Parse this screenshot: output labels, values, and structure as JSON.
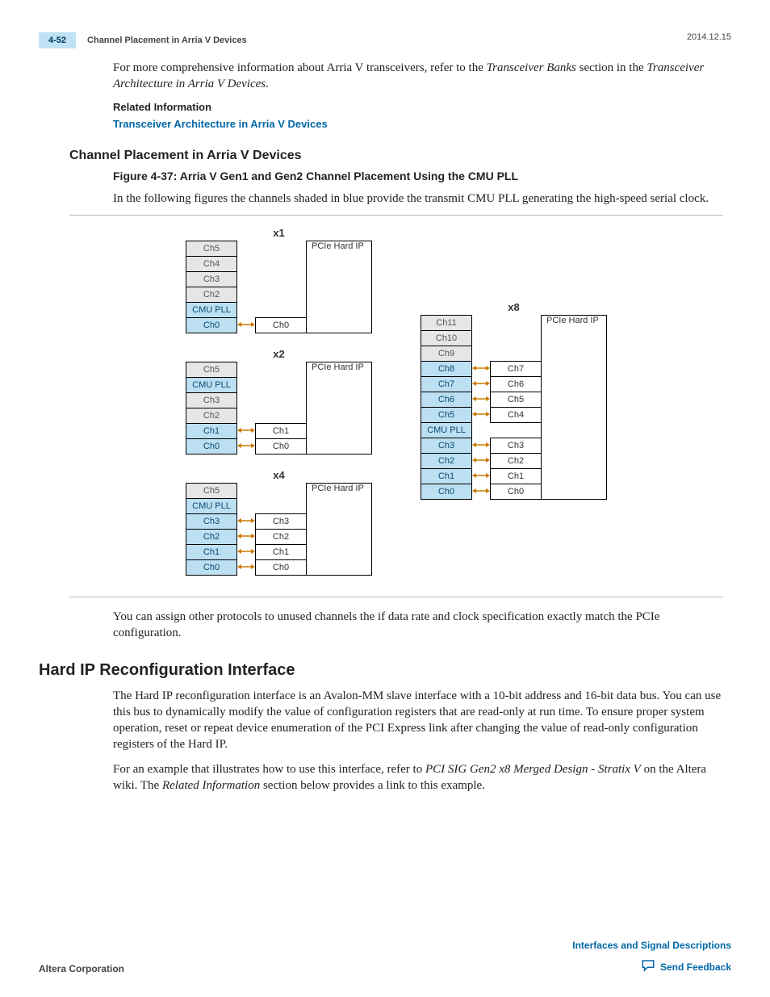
{
  "header": {
    "page_number": "4-52",
    "running_head": "Channel Placement in Arria V Devices",
    "date": "2014.12.15"
  },
  "intro": {
    "p1_a": "For more comprehensive information about Arria V transceivers, refer to the ",
    "p1_i1": "Transceiver Banks",
    "p1_b": " section in the ",
    "p1_i2": "Transceiver Architecture in Arria V Devices",
    "p1_c": ".",
    "relinfo_label": "Related Information",
    "relinfo_link": "Transceiver Architecture in Arria V Devices"
  },
  "section1": {
    "heading": "Channel Placement in Arria V Devices",
    "figcaption": "Figure 4-37: Arria V Gen1 and Gen2 Channel Placement Using the CMU PLL",
    "lead": "In the following figures the channels shaded in blue provide the transmit CMU PLL generating the high-speed serial clock.",
    "after": "You can assign other protocols to unused channels the if data rate and clock specification exactly match the PCIe configuration."
  },
  "section2": {
    "heading": "Hard IP Reconfiguration Interface",
    "p1": "The Hard IP reconfiguration interface is an Avalon-MM slave interface with a 10‑bit address and 16‑bit data bus. You can use this bus to dynamically modify the value of configuration registers that are read-only at run time. To ensure proper system operation, reset or repeat device enumeration of the PCI Express link after changing the value of read‑only configuration registers of the Hard IP.",
    "p2_a": "For an example that illustrates how to use this interface, refer to ",
    "p2_i1": "PCI SIG Gen2 x8 Merged Design - Stratix V",
    "p2_b": " on the Altera wiki. The ",
    "p2_i2": "Related Information",
    "p2_c": " section below provides a link to this example."
  },
  "diagram": {
    "hardip_label": "PCIe Hard IP",
    "x1": {
      "title": "x1",
      "left": [
        {
          "t": "Ch5",
          "c": "grey"
        },
        {
          "t": "Ch4",
          "c": "grey"
        },
        {
          "t": "Ch3",
          "c": "grey"
        },
        {
          "t": "Ch2",
          "c": "grey"
        },
        {
          "t": "CMU PLL",
          "c": "blue"
        },
        {
          "t": "Ch0",
          "c": "blue"
        }
      ],
      "right": [
        null,
        null,
        null,
        null,
        null,
        "Ch0"
      ]
    },
    "x2": {
      "title": "x2",
      "left": [
        {
          "t": "Ch5",
          "c": "grey"
        },
        {
          "t": "CMU PLL",
          "c": "blue"
        },
        {
          "t": "Ch3",
          "c": "grey"
        },
        {
          "t": "Ch2",
          "c": "grey"
        },
        {
          "t": "Ch1",
          "c": "blue"
        },
        {
          "t": "Ch0",
          "c": "blue"
        }
      ],
      "right": [
        null,
        null,
        null,
        null,
        "Ch1",
        "Ch0"
      ]
    },
    "x4": {
      "title": "x4",
      "left": [
        {
          "t": "Ch5",
          "c": "grey"
        },
        {
          "t": "CMU PLL",
          "c": "blue"
        },
        {
          "t": "Ch3",
          "c": "blue"
        },
        {
          "t": "Ch2",
          "c": "blue"
        },
        {
          "t": "Ch1",
          "c": "blue"
        },
        {
          "t": "Ch0",
          "c": "blue"
        }
      ],
      "right": [
        null,
        null,
        "Ch3",
        "Ch2",
        "Ch1",
        "Ch0"
      ]
    },
    "x8": {
      "title": "x8",
      "left": [
        {
          "t": "Ch11",
          "c": "grey"
        },
        {
          "t": "Ch10",
          "c": "grey"
        },
        {
          "t": "Ch9",
          "c": "grey"
        },
        {
          "t": "Ch8",
          "c": "blue"
        },
        {
          "t": "Ch7",
          "c": "blue"
        },
        {
          "t": "Ch6",
          "c": "blue"
        },
        {
          "t": "Ch5",
          "c": "blue"
        },
        {
          "t": "CMU PLL",
          "c": "blue"
        },
        {
          "t": "Ch3",
          "c": "blue"
        },
        {
          "t": "Ch2",
          "c": "blue"
        },
        {
          "t": "Ch1",
          "c": "blue"
        },
        {
          "t": "Ch0",
          "c": "blue"
        }
      ],
      "right": [
        null,
        null,
        null,
        "Ch7",
        "Ch6",
        "Ch5",
        "Ch4",
        null,
        "Ch3",
        "Ch2",
        "Ch1",
        "Ch0"
      ]
    }
  },
  "footer": {
    "corp": "Altera Corporation",
    "doc_link": "Interfaces and Signal Descriptions",
    "feedback": "Send Feedback"
  }
}
